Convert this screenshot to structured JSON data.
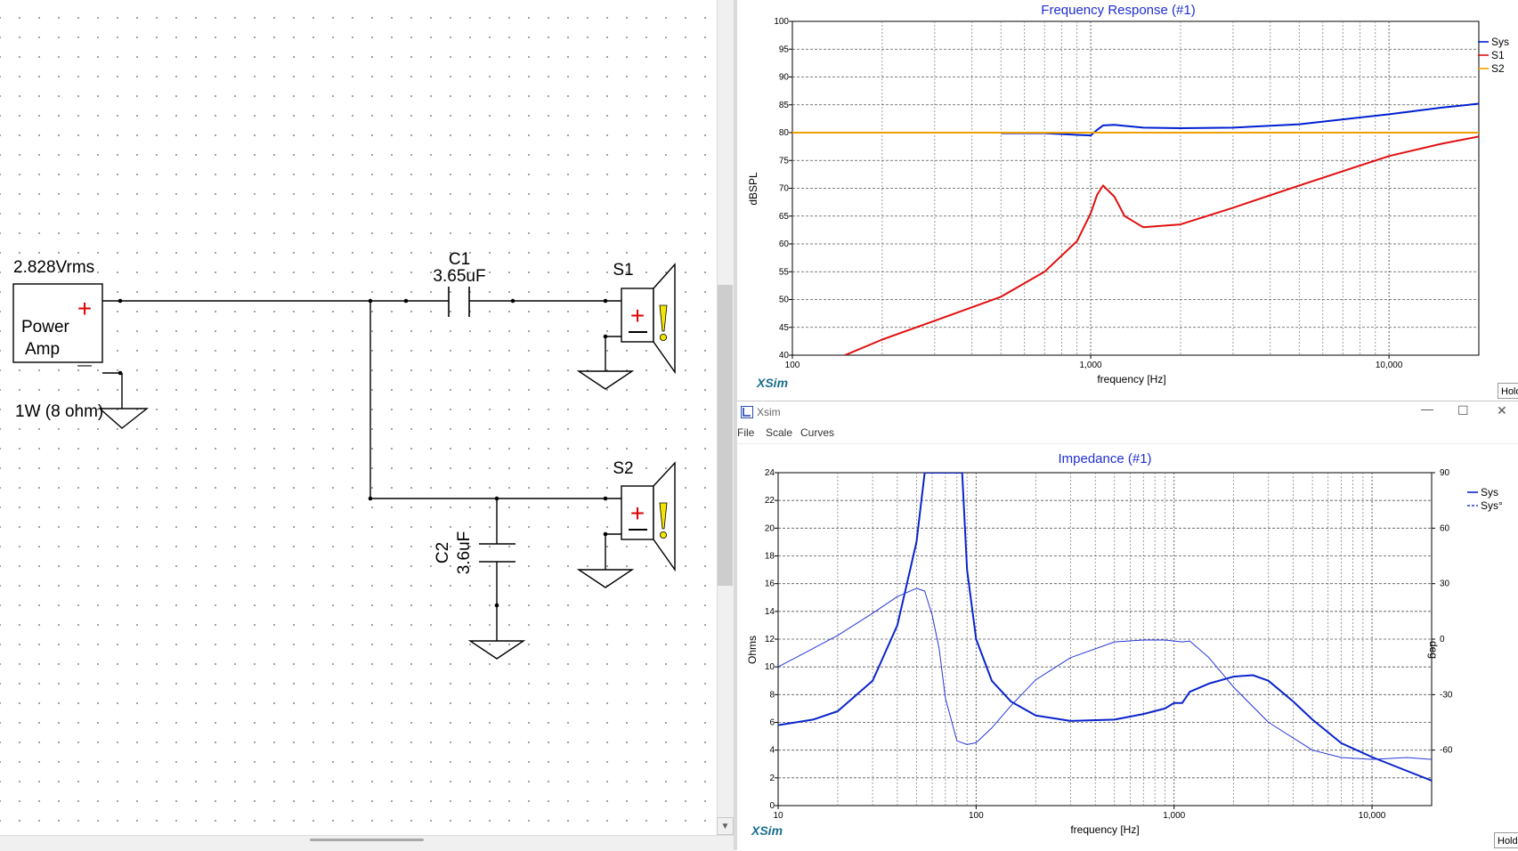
{
  "schematic": {
    "source_voltage": "2.828Vrms",
    "amp_label_line1": "Power",
    "amp_label_line2": "Amp",
    "plus_sign": "+",
    "minus_sign": "—",
    "power_label": "1W (8 ohm)",
    "c1_name": "C1",
    "c1_value": "3.65uF",
    "c2_name": "C2",
    "c2_value": "3.6uF",
    "s1_name": "S1",
    "s2_name": "S2"
  },
  "freq_response": {
    "title": "Frequency Response (#1)",
    "brand": "XSim",
    "hold_label": "Hold",
    "colors": {
      "Sys": "#0020d0",
      "S1": "#e01010",
      "S2": "#f0a000",
      "title": "#1f2fd0"
    },
    "chart_data": {
      "type": "line",
      "title": "Frequency Response (#1)",
      "xlabel": "frequency [Hz]",
      "ylabel": "dBSPL",
      "x_scale": "log",
      "xlim": [
        100,
        20000
      ],
      "ylim": [
        40,
        100
      ],
      "x_ticks": [
        "100",
        "1,000",
        "10,000"
      ],
      "y_ticks": [
        "40",
        "45",
        "50",
        "55",
        "60",
        "65",
        "70",
        "75",
        "80",
        "85",
        "90",
        "95",
        "100"
      ],
      "grid": true,
      "legend_position": "top-right",
      "series": [
        {
          "name": "Sys",
          "x": [
            500,
            700,
            900,
            1000,
            1050,
            1100,
            1200,
            1500,
            2000,
            3000,
            5000,
            10000,
            15000,
            20000
          ],
          "y": [
            79.9,
            79.9,
            79.6,
            79.5,
            80.5,
            81.3,
            81.4,
            80.9,
            80.8,
            80.9,
            81.5,
            83.3,
            84.5,
            85.2
          ]
        },
        {
          "name": "S1",
          "x": [
            150,
            200,
            300,
            500,
            700,
            900,
            1000,
            1050,
            1100,
            1200,
            1300,
            1500,
            2000,
            3000,
            5000,
            10000,
            15000,
            20000
          ],
          "y": [
            40,
            42.8,
            46.2,
            50.5,
            55,
            60.5,
            65.5,
            68.8,
            70.5,
            68.5,
            65,
            63,
            63.5,
            66.5,
            70.5,
            75.8,
            78,
            79.3
          ]
        },
        {
          "name": "S2",
          "x": [
            100,
            20000
          ],
          "y": [
            80,
            80
          ]
        }
      ]
    }
  },
  "impedance_window": {
    "window_title": "Xsim",
    "minimize": "—",
    "maximize": "☐",
    "close": "✕",
    "menu": [
      "File",
      "Scale",
      "Curves"
    ],
    "brand": "XSim",
    "hold_label": "Hold",
    "colors": {
      "Sys": "#0a24cc",
      "Sys_phase": "#2638d8",
      "title": "#1f2fd0"
    },
    "chart_data": {
      "type": "line",
      "title": "Impedance (#1)",
      "xlabel": "frequency [Hz]",
      "ylabel": "Ohms",
      "y2label": "deg",
      "x_scale": "log",
      "xlim": [
        10,
        20000
      ],
      "ylim": [
        0,
        24
      ],
      "y2lim": [
        -90,
        90
      ],
      "x_ticks": [
        "10",
        "100",
        "1,000",
        "10,000"
      ],
      "y_ticks": [
        "0",
        "2",
        "4",
        "6",
        "8",
        "10",
        "12",
        "14",
        "16",
        "18",
        "20",
        "22",
        "24"
      ],
      "y2_ticks": [
        "-60",
        "-30",
        "0",
        "30",
        "60",
        "90"
      ],
      "grid": true,
      "legend_position": "top-right",
      "series": [
        {
          "name": "Sys",
          "axis": "left",
          "x": [
            10,
            15,
            20,
            30,
            40,
            50,
            55,
            58,
            60,
            80,
            85,
            90,
            100,
            120,
            150,
            200,
            300,
            500,
            700,
            900,
            1000,
            1100,
            1200,
            1500,
            2000,
            2500,
            3000,
            4000,
            5000,
            7000,
            10000,
            15000,
            20000
          ],
          "y": [
            5.8,
            6.2,
            6.8,
            9,
            13,
            19,
            24,
            24,
            24,
            24,
            24,
            17,
            12,
            9,
            7.5,
            6.5,
            6.1,
            6.2,
            6.6,
            7,
            7.4,
            7.4,
            8.2,
            8.8,
            9.3,
            9.4,
            9,
            7.5,
            6.2,
            4.5,
            3.5,
            2.5,
            1.8
          ]
        },
        {
          "name": "Sys°",
          "axis": "right",
          "x": [
            10,
            20,
            30,
            40,
            50,
            55,
            60,
            65,
            70,
            80,
            90,
            100,
            120,
            150,
            200,
            300,
            500,
            700,
            900,
            1000,
            1100,
            1200,
            1500,
            2000,
            3000,
            5000,
            7000,
            10000,
            15000,
            20000
          ],
          "y": [
            -15,
            2,
            14,
            23,
            27.5,
            26,
            13,
            -5,
            -32,
            -55,
            -57,
            -56,
            -48,
            -36,
            -22,
            -10,
            -1.5,
            -0.5,
            -0.5,
            -1,
            -1.5,
            -1,
            -10,
            -26,
            -45,
            -60,
            -64,
            -65,
            -64,
            -65
          ]
        }
      ]
    }
  }
}
